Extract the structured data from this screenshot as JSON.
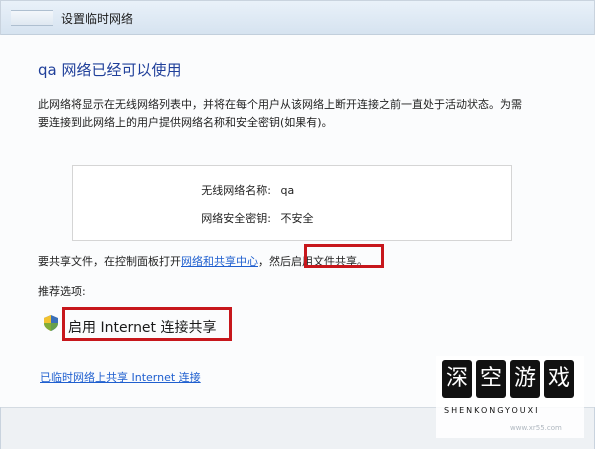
{
  "window": {
    "title": "设置临时网络"
  },
  "main": {
    "heading": "qa 网络已经可以使用",
    "description": "此网络将显示在无线网络列表中，并将在每个用户从该网络上断开连接之前一直处于活动状态。为需要连接到此网络上的用户提供网络名称和安全密钥(如果有)。",
    "network_info": {
      "name_label": "无线网络名称:",
      "name_value": "qa",
      "key_label": "网络安全密钥:",
      "key_value": "不安全"
    },
    "share": {
      "prefix": "要共享文件，在控制面板打开",
      "link": "网络和共享中心",
      "middle": "，然后",
      "highlight": "启用文件共享",
      "suffix": "。"
    },
    "recommend_label": "推荐选项:",
    "ics_label": "启用 Internet 连接共享",
    "stop_link": "已临时网络上共享 Internet 连接"
  },
  "watermark": {
    "chars": [
      "深",
      "空",
      "游",
      "戏"
    ],
    "latin": "SHENKONGYOUXI",
    "site": "www.xr55.com"
  }
}
